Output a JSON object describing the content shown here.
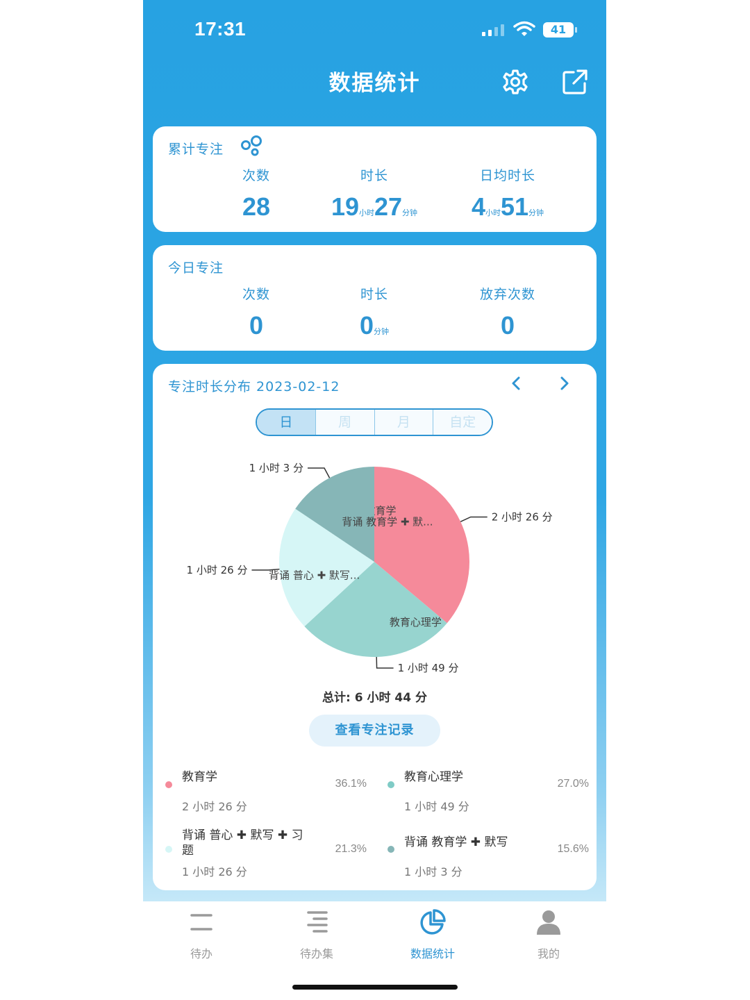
{
  "status_bar": {
    "time": "17:31",
    "battery": "41"
  },
  "header": {
    "title": "数据统计",
    "settings_icon": "gear-icon",
    "share_icon": "share-icon"
  },
  "cumulative": {
    "title": "累计专注",
    "count_label": "次数",
    "count_value": "28",
    "duration_label": "时长",
    "duration_hours": "19",
    "duration_minutes": "27",
    "daily_avg_label": "日均时长",
    "daily_avg_hours": "4",
    "daily_avg_minutes": "51",
    "hour_unit": "小时",
    "minute_unit": "分钟"
  },
  "today": {
    "title": "今日专注",
    "count_label": "次数",
    "count_value": "0",
    "duration_label": "时长",
    "duration_minutes": "0",
    "minute_unit": "分钟",
    "abandon_label": "放弃次数",
    "abandon_value": "0"
  },
  "distribution": {
    "title": "专注时长分布 2023-02-12",
    "tabs": [
      "日",
      "周",
      "月",
      "自定"
    ],
    "active_tab": "日",
    "total": "总计: 6 小时 44 分",
    "records_button": "查看专注记录"
  },
  "chart_data": {
    "type": "pie",
    "slices": [
      {
        "name": "教育学",
        "minutes": 146,
        "percent": 36.1,
        "label": "2 小时 26 分",
        "color": "#f58a9a"
      },
      {
        "name": "教育心理学",
        "minutes": 109,
        "percent": 27.0,
        "label": "1 小时 49 分",
        "color": "#97d4cf"
      },
      {
        "name": "背诵 普心 ✚ 默写...",
        "minutes": 86,
        "percent": 21.3,
        "label": "1 小时 26 分",
        "color": "#d6f6f6"
      },
      {
        "name": "背诵 教育学 ✚ 默...",
        "minutes": 63,
        "percent": 15.6,
        "label": "1 小时 3 分",
        "color": "#86b6b7"
      }
    ]
  },
  "legend": [
    {
      "name": "教育学",
      "duration": "2 小时 26 分",
      "percent": "36.1%",
      "color": "#f58a9a"
    },
    {
      "name": "教育心理学",
      "duration": "1 小时 49 分",
      "percent": "27.0%",
      "color": "#7fcbc6"
    },
    {
      "name": "背诵 普心 ✚ 默写 ✚ 习题",
      "duration": "1 小时 26 分",
      "percent": "21.3%",
      "color": "#d6f6f6"
    },
    {
      "name": "背诵 教育学 ✚ 默写",
      "duration": "1 小时 3 分",
      "percent": "15.6%",
      "color": "#86b6b7"
    }
  ],
  "tabbar": [
    {
      "label": "待办",
      "icon": "list-icon"
    },
    {
      "label": "待办集",
      "icon": "list-set-icon"
    },
    {
      "label": "数据统计",
      "icon": "pie-chart-icon",
      "active": true
    },
    {
      "label": "我的",
      "icon": "person-icon"
    }
  ]
}
